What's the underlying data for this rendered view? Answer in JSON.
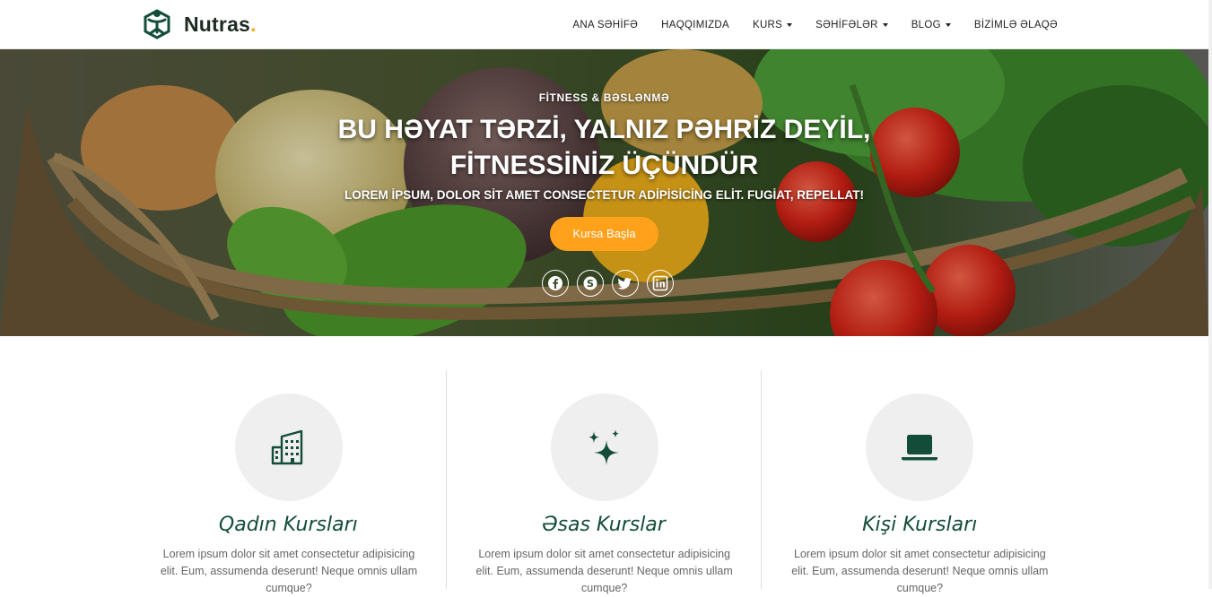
{
  "brand": {
    "name": "Nutras",
    "dot": "."
  },
  "nav": {
    "items": [
      {
        "label": "ANA SƏHİFƏ",
        "dropdown": false
      },
      {
        "label": "HAQQIMIZDA",
        "dropdown": false
      },
      {
        "label": "KURS",
        "dropdown": true
      },
      {
        "label": "SƏHİFƏLƏR",
        "dropdown": true
      },
      {
        "label": "BLOG",
        "dropdown": true
      },
      {
        "label": "BİZİMLƏ ƏLAQƏ",
        "dropdown": false
      }
    ]
  },
  "hero": {
    "eyebrow": "FİTNESS & BƏSLƏNMƏ",
    "title_line1": "BU HƏYAT TƏRZİ, YALNIZ PƏHRİZ DEYİL,",
    "title_line2": "FİTNESSİNİZ ÜÇÜNDÜR",
    "subtitle": "LOREM İPSUM, DOLOR SİT AMET CONSECTETUR ADİPİSİCİNG ELİT. FUGİAT, REPELLAT!",
    "cta_label": "Kursa Başla",
    "socials": [
      "facebook-icon",
      "skype-icon",
      "twitter-icon",
      "linkedin-icon"
    ]
  },
  "features": [
    {
      "icon": "buildings-icon",
      "title": "Qadın Kursları",
      "text": "Lorem ipsum dolor sit amet consectetur adipisicing elit. Eum, assumenda deserunt! Neque omnis ullam cumque?"
    },
    {
      "icon": "sparkles-icon",
      "title": "Əsas Kurslar",
      "text": "Lorem ipsum dolor sit amet consectetur adipisicing elit. Eum, assumenda deserunt! Neque omnis ullam cumque?"
    },
    {
      "icon": "laptop-icon",
      "title": "Kişi Kursları",
      "text": "Lorem ipsum dolor sit amet consectetur adipisicing elit. Eum, assumenda deserunt! Neque omnis ullam cumque?"
    }
  ],
  "colors": {
    "accent": "#ffa11a",
    "brand_green": "#134d3a",
    "circle_bg": "#efefef"
  }
}
